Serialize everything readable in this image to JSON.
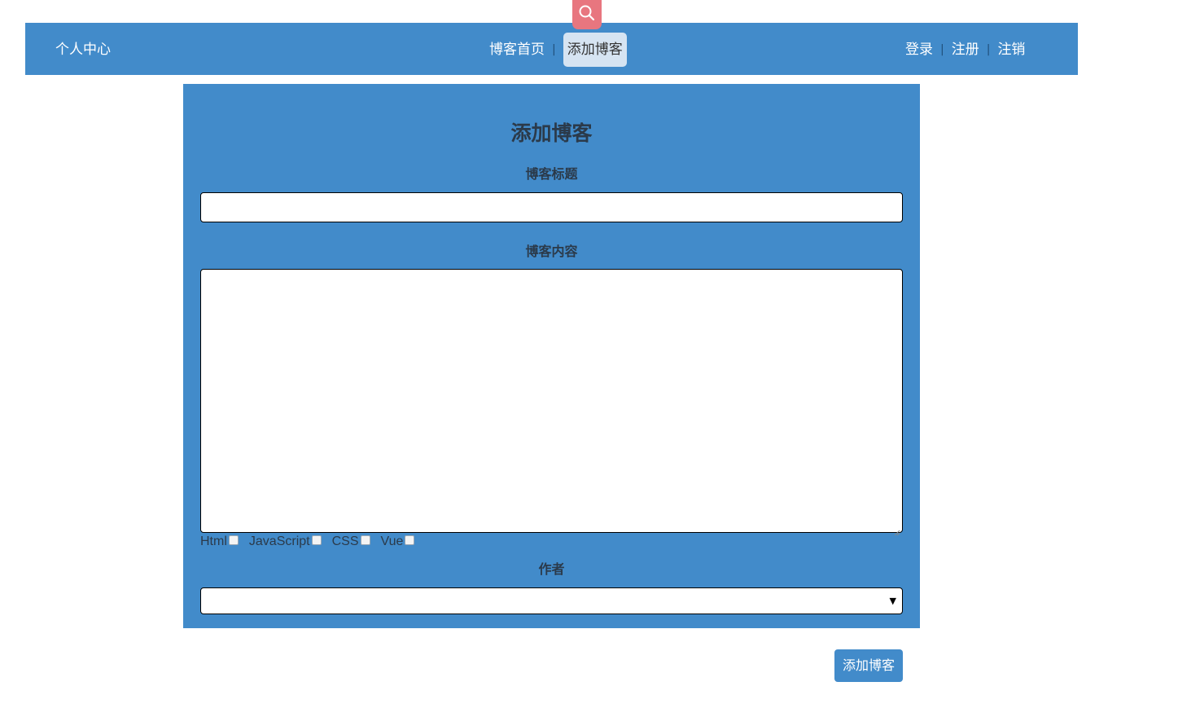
{
  "search": {
    "icon": "search-icon",
    "color": "#e8767f"
  },
  "navbar": {
    "left_link": "个人中心",
    "center_links": [
      {
        "label": "博客首页",
        "active": false
      },
      {
        "label": "添加博客",
        "active": true
      }
    ],
    "separator": "|",
    "right_links": [
      {
        "label": "登录"
      },
      {
        "label": "注册"
      },
      {
        "label": "注销"
      }
    ],
    "background_color": "#428bca"
  },
  "form": {
    "title": "添加博客",
    "title_label": "博客标题",
    "title_value": "",
    "content_label": "博客内容",
    "content_value": "",
    "tags": [
      {
        "label": "Html",
        "checked": false
      },
      {
        "label": "JavaScript",
        "checked": false
      },
      {
        "label": "CSS",
        "checked": false
      },
      {
        "label": "Vue",
        "checked": false
      }
    ],
    "author_label": "作者",
    "author_selected": "",
    "select_arrow": "▼"
  },
  "submit": {
    "label": "添加博客"
  }
}
